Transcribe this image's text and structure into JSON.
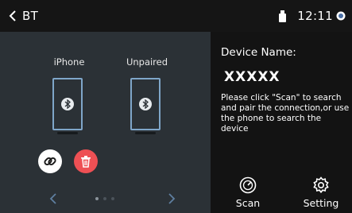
{
  "header": {
    "title": "BT",
    "time": "12:11",
    "icons": [
      "back-chevron-icon",
      "usb-icon",
      "status-dot-icon"
    ]
  },
  "devices": [
    {
      "name": "iPhone",
      "icon": "phone-bluetooth-icon"
    },
    {
      "name": "Unpaired",
      "icon": "phone-bluetooth-icon"
    }
  ],
  "actions": {
    "link_icon": "link-icon",
    "delete_icon": "trash-icon"
  },
  "pager": {
    "pages": 3,
    "current": 1
  },
  "info": {
    "device_name_label": "Device Name:",
    "device_name": "XXXXX",
    "hint": "Please click \"Scan\" to search and pair the connection,or use the phone to search the device"
  },
  "toolbar": {
    "scan_label": "Scan",
    "setting_label": "Setting"
  },
  "colors": {
    "left_panel": "#2b3136",
    "phone_outline": "#7fa6c9",
    "delete_red": "#ee5054"
  }
}
